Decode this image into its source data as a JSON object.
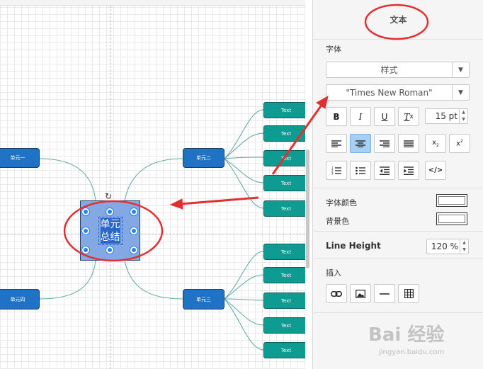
{
  "canvas": {
    "nodes": {
      "left_top": "单元一",
      "left_bottom": "单元四",
      "right_top": "单元二",
      "right_bottom": "单元三",
      "center": [
        "单元",
        "总结"
      ]
    },
    "leaf_label": "Text",
    "colors": {
      "branch_node": "#1f72c4",
      "leaf_node": "#0d9b92",
      "center_node": "#84a8e3",
      "link": "#5aa6a0"
    }
  },
  "panel": {
    "title": "文本",
    "font_section": "字体",
    "style_select": "样式",
    "font_select": "\"Times New Roman\"",
    "font_size": "15 pt",
    "format_buttons": [
      "B",
      "I",
      "U",
      "Tx"
    ],
    "align_buttons": [
      "align-left-icon",
      "align-center-icon",
      "align-right-icon",
      "align-justify-icon",
      "subscript-icon",
      "superscript-icon"
    ],
    "list_buttons": [
      "numbered-list-icon",
      "bullet-list-icon",
      "outdent-icon",
      "indent-icon",
      "code-icon"
    ],
    "font_color_label": "字体颜色",
    "bg_color_label": "背景色",
    "line_height_label": "Line Height",
    "line_height_value": "120 %",
    "insert_label": "插入",
    "insert_buttons": [
      "link-icon",
      "image-icon",
      "horizontal-rule-icon",
      "table-icon"
    ]
  },
  "annotation_color": "#e03030",
  "watermark": {
    "main": "Bai 经验",
    "sub": "jingyan.baidu.com"
  }
}
